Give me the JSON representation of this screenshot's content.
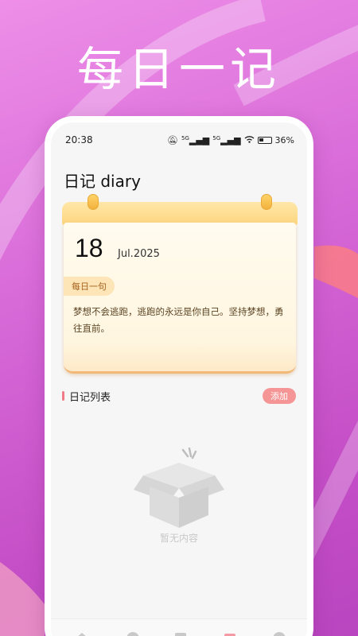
{
  "promo": {
    "headline": "每日一记"
  },
  "status_bar": {
    "time": "20:38",
    "network_1": "5G",
    "network_2": "5G",
    "battery": "36%",
    "icons": [
      "mute-icon",
      "signal-5g-icon",
      "signal-5g-icon",
      "wifi-icon",
      "battery-icon"
    ]
  },
  "app": {
    "title": "日记 diary"
  },
  "calendar": {
    "day": "18",
    "month_year": "Jul.2025",
    "quote_label": "每日一句",
    "quote_text": "梦想不会逃跑，逃跑的永远是你自己。坚持梦想，勇往直前。"
  },
  "diary_list": {
    "title": "日记列表",
    "add_label": "添加",
    "empty_text": "暂无内容"
  },
  "tab_bar": {
    "icons": [
      "home-icon",
      "discover-icon",
      "note-icon",
      "calendar-icon",
      "profile-icon"
    ]
  },
  "colors": {
    "background": "#d86ad8",
    "accent": "#f59595",
    "calendar_header": "#fcd57e",
    "quote_tag": "#fde5b8"
  }
}
